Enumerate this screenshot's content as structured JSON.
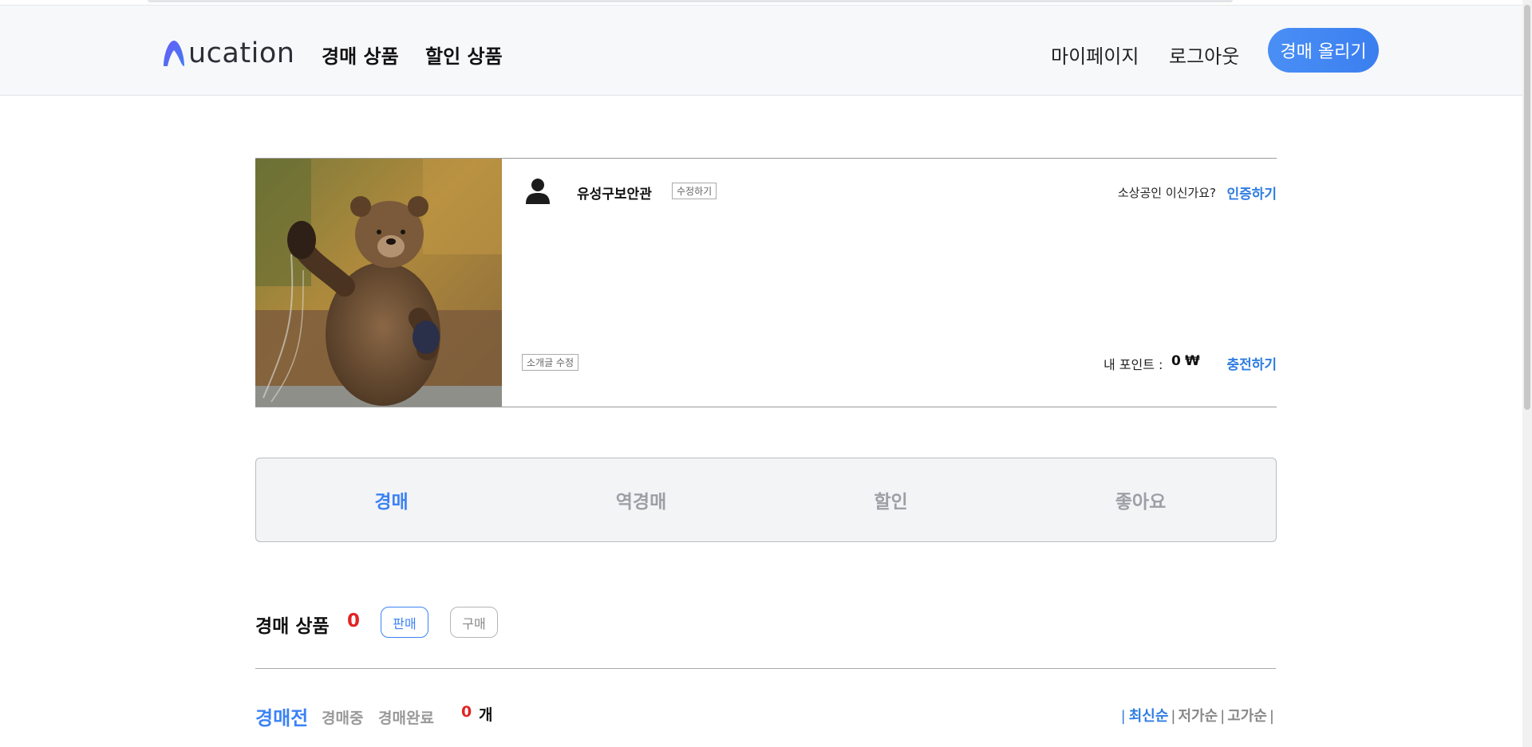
{
  "header": {
    "logo_text": "ucation",
    "nav": [
      "경매 상품",
      "할인 상품"
    ],
    "mypage": "마이페이지",
    "logout": "로그아웃",
    "post_button": "경매 올리기",
    "accent_color": "#3b82f6"
  },
  "profile": {
    "username": "유성구보안관",
    "edit_label": "수정하기",
    "intro_edit_label": "소개글 수정",
    "business_question": "소상공인 이신가요?",
    "verify_link": "인증하기",
    "points_label": "내 포인트 :",
    "points_value": "0",
    "points_currency": "₩",
    "charge_link": "충전하기",
    "user_icon": "person-icon",
    "photo": "bear-waving-photo"
  },
  "tabs": [
    "경매",
    "역경매",
    "할인",
    "좋아요"
  ],
  "active_tab": "경매",
  "section": {
    "title": "경매 상품",
    "count": "0",
    "sell_pill": "판매",
    "buy_pill": "구매"
  },
  "status_filters": [
    "경매전",
    "경매중",
    "경매완료"
  ],
  "item_count": "0",
  "item_unit": "개",
  "sort": {
    "latest": "최신순",
    "low_price": "저가순",
    "high_price": "고가순"
  }
}
